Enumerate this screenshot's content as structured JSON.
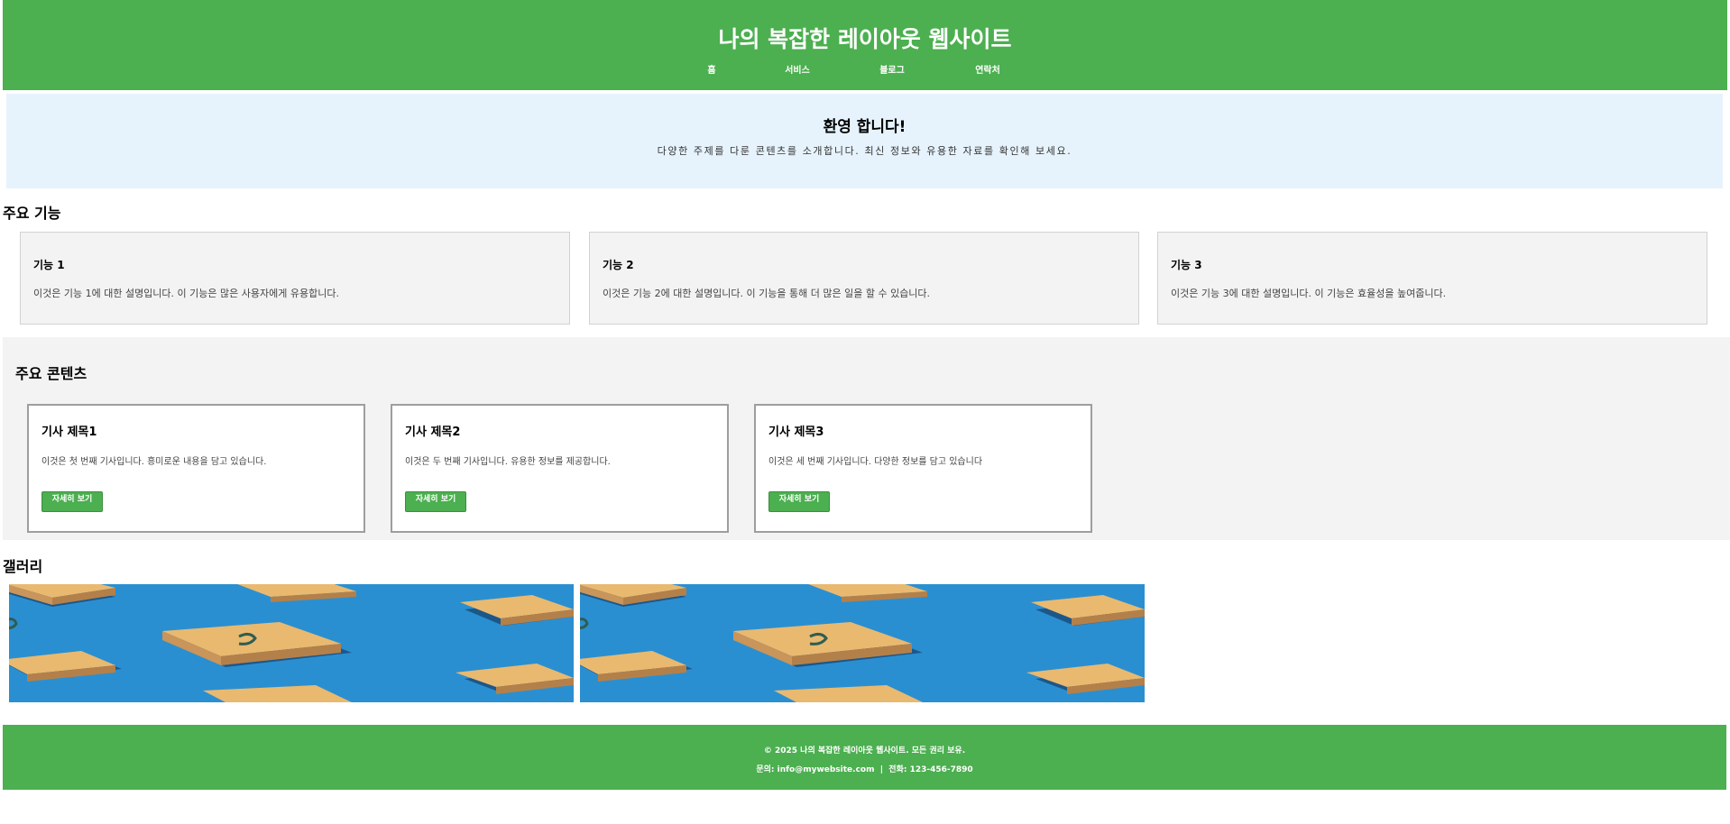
{
  "header": {
    "title": "나의 복잡한 레이아웃 웹사이트",
    "nav": [
      "홈",
      "서비스",
      "블로그",
      "연락처"
    ]
  },
  "hero": {
    "title": "환영 합니다!",
    "text": "다양한 주제를 다룬 콘텐츠를 소개합니다. 최신 정보와 유용한 자료를 확인해 보세요."
  },
  "features": {
    "heading": "주요 기능",
    "items": [
      {
        "title": "기능 1",
        "text": "이것은 기능 1에 대한 설명입니다. 이 기능은 많은 사용자에게 유용합니다."
      },
      {
        "title": "기능 2",
        "text": "이것은 기능 2에 대한 설명입니다. 이 기능을 통해 더 많은 일을 할 수 있습니다."
      },
      {
        "title": "기능 3",
        "text": "이것은 기능 3에 대한 설명입니다. 이 기능은 효율성을 높여줍니다."
      }
    ]
  },
  "content": {
    "heading": "주요 콘텐츠",
    "articles": [
      {
        "title": "기사 제목1",
        "text": "이것은 첫 번째 기사입니다. 흥미로운 내용을 담고 있습니다.",
        "button": "자세히 보기"
      },
      {
        "title": "기사 제목2",
        "text": "이것은 두 번째 기사입니다. 유용한 정보를 제공합니다.",
        "button": "자세히 보기"
      },
      {
        "title": "기사 제목3",
        "text": "이것은 세 번째 기사입니다. 다양한 정보를 담고 있습니다",
        "button": "자세히 보기"
      }
    ]
  },
  "gallery": {
    "heading": "갤러리",
    "images": [
      "gallery-image-1",
      "gallery-image-2"
    ]
  },
  "footer": {
    "copyright": "© 2025 나의 복잡한 레이아웃 웹사이트. 모든 권리 보유.",
    "contact": "문의: info@mywebsite.com  |  전화: 123-456-7890"
  },
  "colors": {
    "accent": "#4caf50",
    "hero_bg": "#e6f3fc",
    "card_bg": "#f3f3f3"
  }
}
